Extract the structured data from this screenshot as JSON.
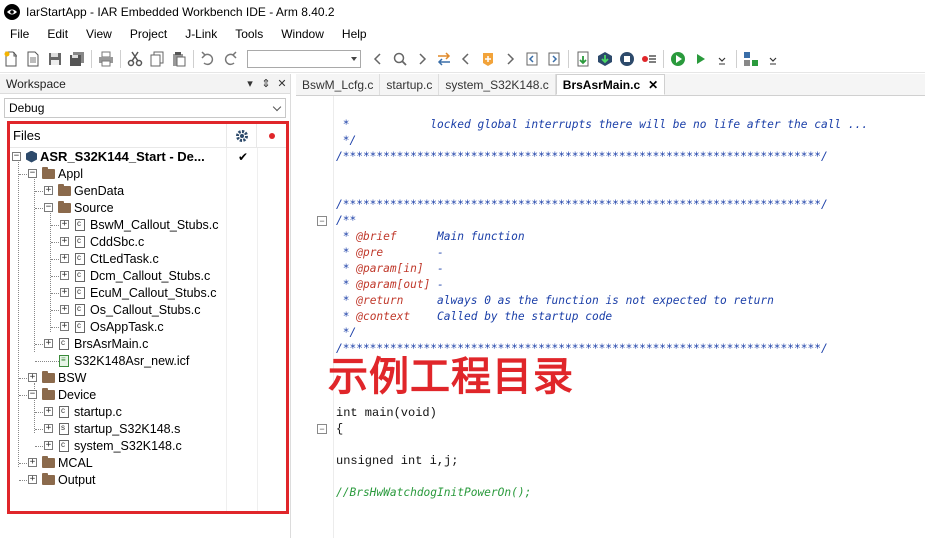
{
  "window": {
    "title": "IarStartApp - IAR Embedded Workbench IDE - Arm 8.40.2"
  },
  "menu": [
    "File",
    "Edit",
    "View",
    "Project",
    "J-Link",
    "Tools",
    "Window",
    "Help"
  ],
  "toolbar": {
    "combo_value": ""
  },
  "workspace": {
    "title": "Workspace",
    "pin": "▾",
    "pin2": "⇕",
    "close": "✕",
    "config": "Debug",
    "files_header": "Files",
    "tree": {
      "project": "ASR_S32K144_Start - De...",
      "appl": "Appl",
      "gendata": "GenData",
      "source": "Source",
      "source_files": [
        "BswM_Callout_Stubs.c",
        "CddSbc.c",
        "CtLedTask.c",
        "Dcm_Callout_Stubs.c",
        "EcuM_Callout_Stubs.c",
        "Os_Callout_Stubs.c",
        "OsAppTask.c"
      ],
      "brs": "BrsAsrMain.c",
      "icf": "S32K148Asr_new.icf",
      "bsw": "BSW",
      "device": "Device",
      "device_files": [
        "startup.c",
        "startup_S32K148.s",
        "system_S32K148.c"
      ],
      "mcal": "MCAL",
      "output": "Output"
    }
  },
  "annotation": "示例工程目录",
  "editor": {
    "tabs": [
      "BswM_Lcfg.c",
      "startup.c",
      "system_S32K148.c",
      "BrsAsrMain.c"
    ],
    "active_tab_close": "✕",
    "code": {
      "l1_star": " *",
      "l1_text": "            locked global interrupts there will be no life after the call ...",
      "l2": " */",
      "l3": "/***********************************************************************/",
      "l4": "/***********************************************************************/",
      "l5": "/**",
      "l6_tag": "@brief",
      "l6_text": "      Main function",
      "l7_tag": "@pre",
      "l7_text": "        -",
      "l8_tag": "@param[in]",
      "l8_text": "  -",
      "l9_tag": "@param[out]",
      "l9_text": " -",
      "l10_tag": "@return",
      "l10_text": "     always 0 as the function is not expected to return",
      "l11_tag": "@context",
      "l11_text": "    Called by the startup code",
      "l12": " */",
      "l13": "/***********************************************************************/",
      "l14": "int main(void)",
      "l15": "{",
      "l16": "unsigned int i,j;",
      "l17": "//BrsHwWatchdogInitPowerOn();"
    }
  }
}
